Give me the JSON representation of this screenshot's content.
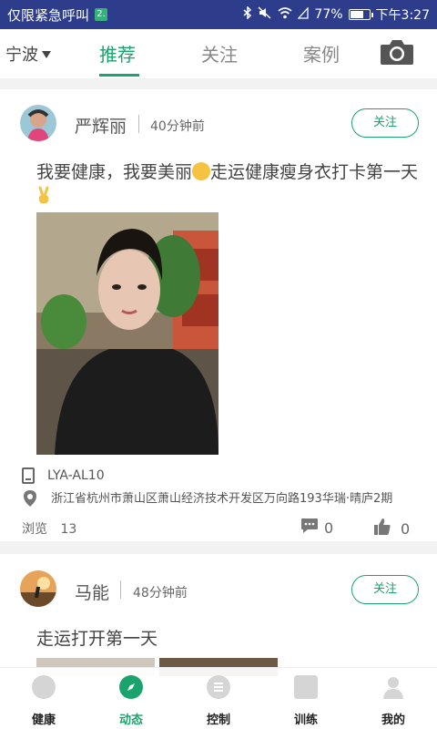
{
  "statusbar": {
    "carrier": "仅限紧急呼叫",
    "badge": "2.",
    "battery_percent": "77%",
    "battery_level": 0.77,
    "time": "下午3:27"
  },
  "topnav": {
    "city": "宁波",
    "tabs": [
      {
        "label": "推荐",
        "active": true
      },
      {
        "label": "关注",
        "active": false
      },
      {
        "label": "案例",
        "active": false
      }
    ],
    "camera_icon": "camera-icon"
  },
  "posts": [
    {
      "username": "严辉丽",
      "time": "40分钟前",
      "follow_label": "关注",
      "content_a": "我要健康，我要美丽",
      "content_b": "走运健康瘦身衣打卡第一天",
      "device": "LYA-AL10",
      "location": "浙江省杭州市萧山区萧山经济技术开发区万向路193华瑞·晴庐2期",
      "views_label": "浏览",
      "views": "13",
      "comments": "0",
      "likes": "0"
    },
    {
      "username": "马能",
      "time": "48分钟前",
      "follow_label": "关注",
      "content": "走运打开第一天"
    }
  ],
  "bottombar": {
    "items": [
      {
        "label": "健康",
        "icon": "health-icon",
        "active": false
      },
      {
        "label": "动态",
        "icon": "compass-icon",
        "active": true
      },
      {
        "label": "控制",
        "icon": "control-icon",
        "active": false
      },
      {
        "label": "训练",
        "icon": "training-icon",
        "active": false
      },
      {
        "label": "我的",
        "icon": "profile-icon",
        "active": false
      }
    ]
  },
  "colors": {
    "accent": "#1aa36d",
    "statusbar": "#2d3d8c"
  }
}
